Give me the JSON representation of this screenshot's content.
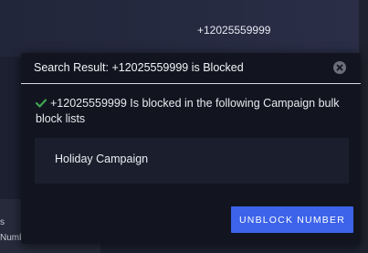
{
  "background": {
    "phone_number": "+12025559999",
    "left_panel_line1": "s",
    "left_panel_line2": "Numb"
  },
  "dialog": {
    "title": "Search Result: +12025559999 is Blocked",
    "close_icon": "close-circle-icon",
    "message": "+12025559999 Is blocked in the following Campaign bulk block lists",
    "message_icon": "check-icon",
    "campaigns": [
      "Holiday Campaign"
    ],
    "unblock_label": "UNBLOCK NUMBER"
  },
  "colors": {
    "accent": "#3d63ea",
    "success": "#3fa650",
    "dialog_bg": "#121520"
  }
}
